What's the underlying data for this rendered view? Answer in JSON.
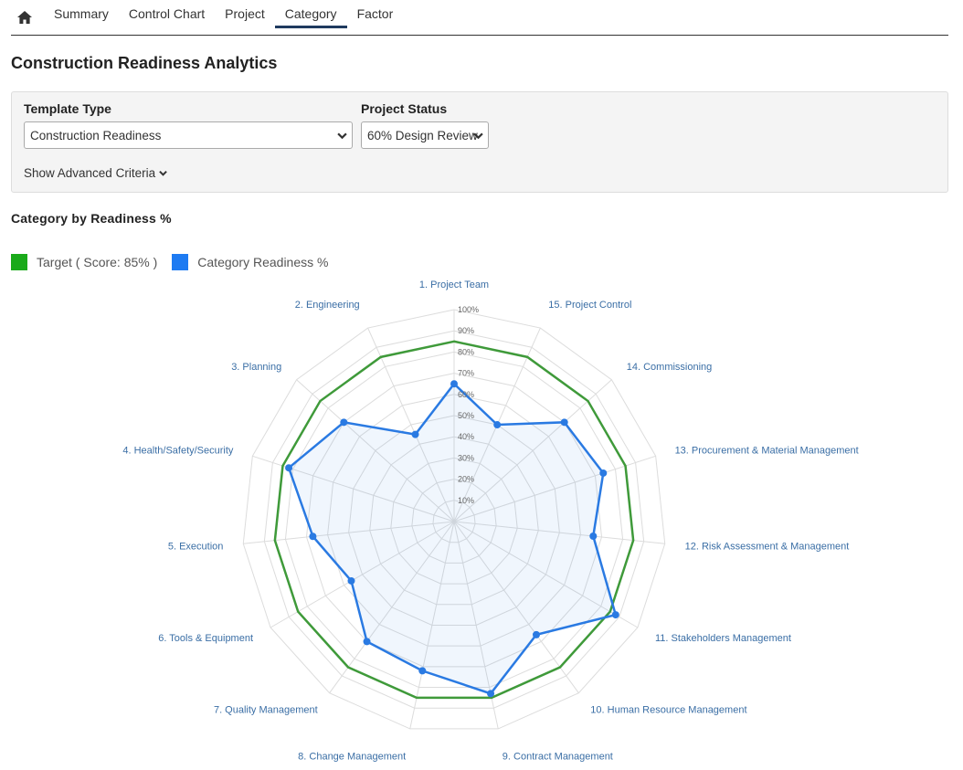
{
  "nav": {
    "home_icon": "home-icon",
    "tabs": [
      {
        "label": "Summary"
      },
      {
        "label": "Control Chart"
      },
      {
        "label": "Project"
      },
      {
        "label": "Category"
      },
      {
        "label": "Factor"
      }
    ],
    "active_tab": "Category"
  },
  "page": {
    "title": "Construction Readiness Analytics"
  },
  "criteria": {
    "template_type": {
      "label": "Template Type",
      "value": "Construction Readiness"
    },
    "project_status": {
      "label": "Project Status",
      "value": "60% Design Review"
    },
    "advanced_label": "Show Advanced Criteria"
  },
  "chart_data": {
    "type": "radar",
    "title": "Category by Readiness %",
    "categories": [
      "1. Project Team",
      "2. Engineering",
      "3. Planning",
      "4. Health/Safety/Security",
      "5. Execution",
      "6. Tools & Equipment",
      "7. Quality Management",
      "8. Change Management",
      "9. Contract Management",
      "10. Human Resource Management",
      "11. Stakeholders Management",
      "12. Risk Assessment & Management",
      "13. Procurement & Material Management",
      "14. Commissioning",
      "15. Project Control"
    ],
    "tick_labels": [
      "10%",
      "20%",
      "30%",
      "40%",
      "50%",
      "60%",
      "70%",
      "80%",
      "90%",
      "100%"
    ],
    "range": [
      0,
      100
    ],
    "series": [
      {
        "name": "Target ( Score: 85% )",
        "color": "#3f9a3a",
        "values": [
          85,
          85,
          85,
          85,
          85,
          85,
          85,
          85,
          85,
          85,
          85,
          85,
          85,
          85,
          85
        ]
      },
      {
        "name": "Category Readiness %",
        "color": "#2a7ae2",
        "values": [
          65,
          45,
          70,
          82,
          67,
          56,
          70,
          72,
          83,
          66,
          88,
          66,
          74,
          70,
          50
        ]
      }
    ],
    "legend_swatch_colors": [
      "#1aaa1a",
      "#1e7bf2"
    ],
    "grid": true
  }
}
